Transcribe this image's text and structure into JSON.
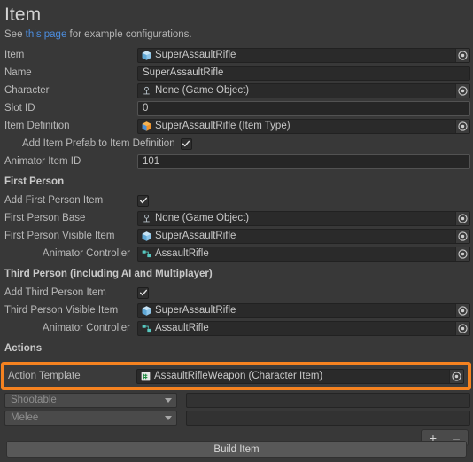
{
  "header": {
    "title": "Item",
    "help_prefix": "See ",
    "help_link": "this page",
    "help_suffix": " for example configurations."
  },
  "fields": {
    "item": {
      "label": "Item",
      "value": "SuperAssaultRifle",
      "icon": "prefab-cube-icon",
      "picker_icon": "object-picker-icon"
    },
    "name": {
      "label": "Name",
      "value": "SuperAssaultRifle"
    },
    "character": {
      "label": "Character",
      "value": "None (Game Object)",
      "icon": "game-object-icon",
      "picker_icon": "object-picker-icon"
    },
    "slot_id": {
      "label": "Slot ID",
      "value": "0"
    },
    "item_definition": {
      "label": "Item Definition",
      "value": "SuperAssaultRifle (Item Type)",
      "icon": "scriptable-object-icon",
      "picker_icon": "object-picker-icon"
    },
    "add_item_prefab": {
      "label": "Add Item Prefab to Item Definition",
      "checked": true
    },
    "animator_item_id": {
      "label": "Animator Item ID",
      "value": "101"
    }
  },
  "first_person": {
    "section_label": "First Person",
    "add_item": {
      "label": "Add First Person Item",
      "checked": true
    },
    "base": {
      "label": "First Person Base",
      "value": "None (Game Object)",
      "icon": "game-object-icon",
      "picker_icon": "object-picker-icon"
    },
    "visible_item": {
      "label": "First Person Visible Item",
      "value": "SuperAssaultRifle",
      "icon": "prefab-cube-icon",
      "picker_icon": "object-picker-icon"
    },
    "animator_controller": {
      "label": "Animator Controller",
      "value": "AssaultRifle",
      "icon": "animator-controller-icon",
      "picker_icon": "object-picker-icon"
    }
  },
  "third_person": {
    "section_label": "Third Person (including AI and Multiplayer)",
    "add_item": {
      "label": "Add Third Person Item",
      "checked": true
    },
    "visible_item": {
      "label": "Third Person Visible Item",
      "value": "SuperAssaultRifle",
      "icon": "prefab-cube-icon",
      "picker_icon": "object-picker-icon"
    },
    "animator_controller": {
      "label": "Animator Controller",
      "value": "AssaultRifle",
      "icon": "animator-controller-icon",
      "picker_icon": "object-picker-icon"
    }
  },
  "actions": {
    "section_label": "Actions",
    "action_template": {
      "label": "Action Template",
      "value": "AssaultRifleWeapon (Character Item)",
      "icon": "cs-script-icon",
      "picker_icon": "object-picker-icon"
    },
    "highlight_color": "#f58220",
    "rows": [
      {
        "dropdown": "Shootable",
        "value": ""
      },
      {
        "dropdown": "Melee",
        "value": ""
      }
    ],
    "add_label": "+",
    "remove_label": "–"
  },
  "footer": {
    "build_label": "Build Item"
  }
}
